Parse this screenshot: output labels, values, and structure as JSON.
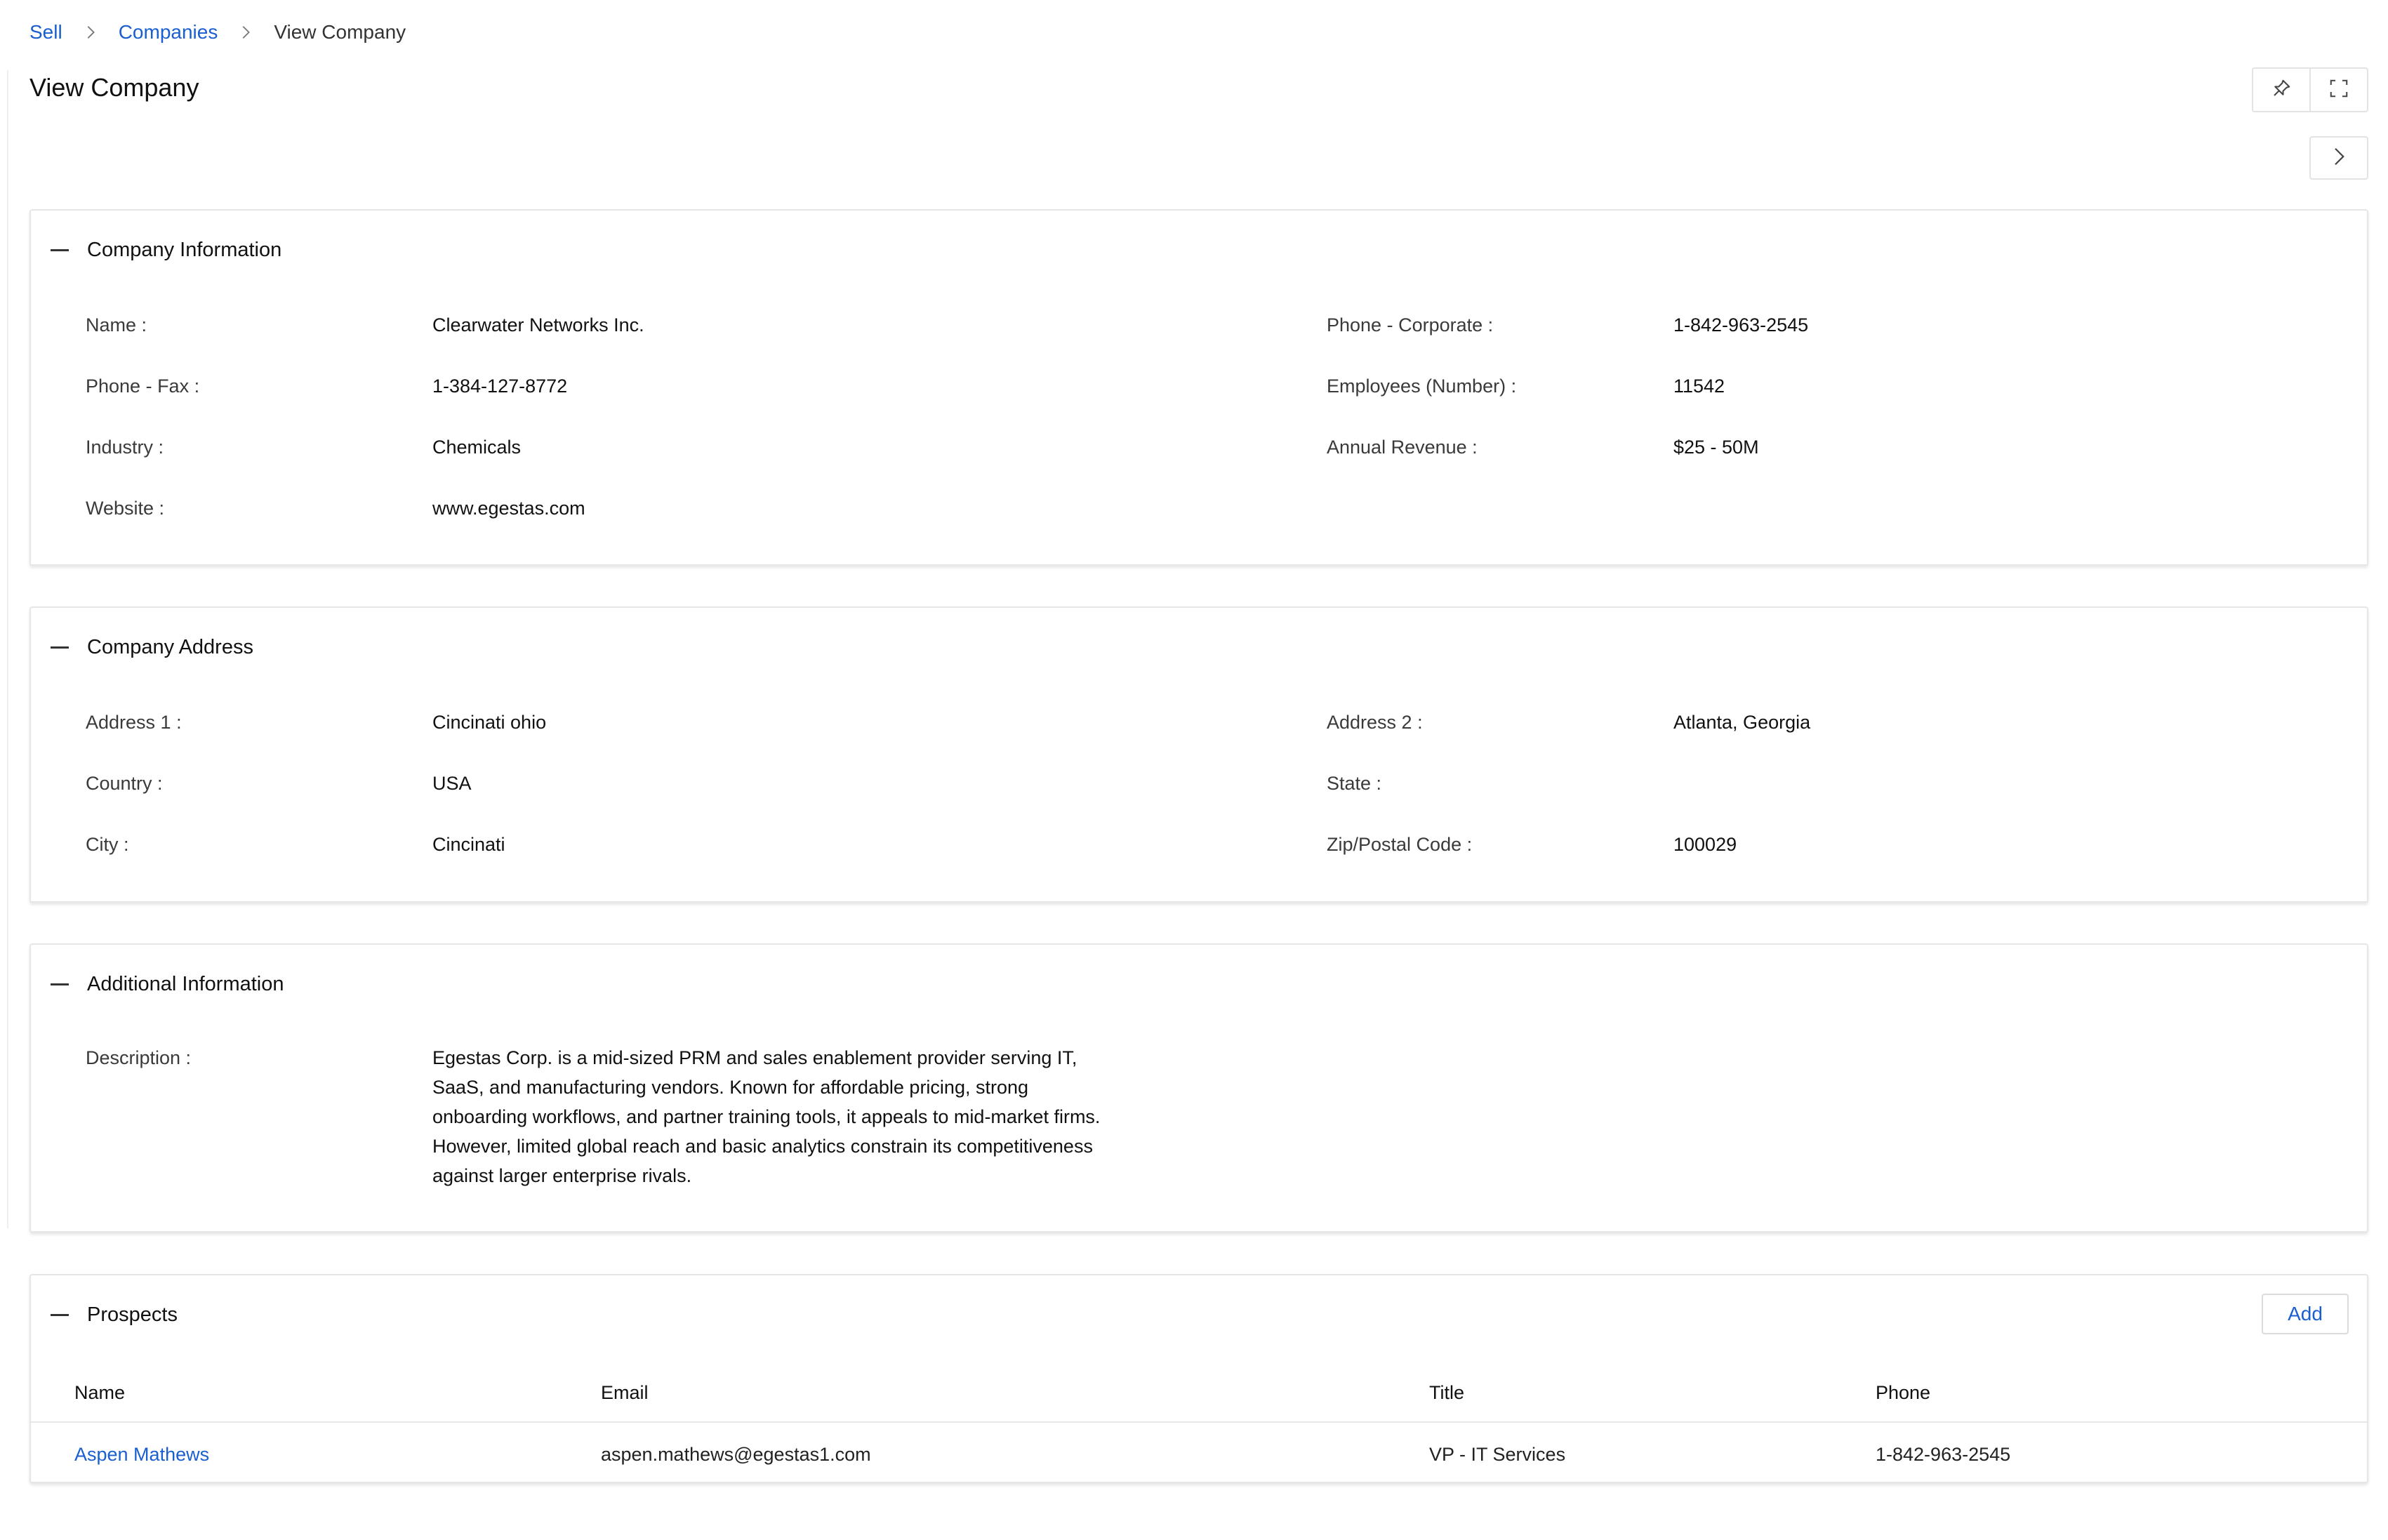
{
  "breadcrumb": {
    "items": [
      "Sell",
      "Companies"
    ],
    "current": "View Company"
  },
  "page": {
    "title": "View Company"
  },
  "toolbar": {
    "pin_icon": "pin-icon",
    "fullscreen_icon": "fullscreen-icon",
    "next_icon": "chevron-right-icon"
  },
  "company_info": {
    "title": "Company Information",
    "fields": [
      {
        "label": "Name :",
        "value": "Clearwater Networks Inc."
      },
      {
        "label": "Phone - Corporate :",
        "value": "1-842-963-2545"
      },
      {
        "label": "Phone - Fax :",
        "value": "1-384-127-8772"
      },
      {
        "label": "Employees (Number) :",
        "value": "11542"
      },
      {
        "label": "Industry :",
        "value": "Chemicals"
      },
      {
        "label": "Annual Revenue :",
        "value": "$25 - 50M"
      },
      {
        "label": "Website :",
        "value": "www.egestas.com"
      }
    ]
  },
  "company_address": {
    "title": "Company Address",
    "fields": [
      {
        "label": "Address 1 :",
        "value": "Cincinati ohio"
      },
      {
        "label": "Address 2 :",
        "value": "Atlanta, Georgia"
      },
      {
        "label": "Country :",
        "value": "USA"
      },
      {
        "label": "State :",
        "value": ""
      },
      {
        "label": "City :",
        "value": "Cincinati"
      },
      {
        "label": "Zip/Postal Code :",
        "value": "100029"
      }
    ]
  },
  "additional_info": {
    "title": "Additional Information",
    "description_label": "Description :",
    "description": "Egestas Corp. is a mid-sized PRM and sales enablement provider serving IT, SaaS, and manufacturing vendors. Known for affordable pricing, strong onboarding workflows, and partner training tools, it appeals to mid-market firms. However, limited global reach and basic analytics constrain its competitiveness against larger enterprise rivals."
  },
  "prospects": {
    "title": "Prospects",
    "add_label": "Add",
    "columns": [
      "Name",
      "Email",
      "Title",
      "Phone"
    ],
    "rows": [
      [
        "Aspen Mathews",
        "aspen.mathews@egestas1.com",
        "VP - IT Services",
        "1-842-963-2545"
      ]
    ]
  },
  "colors": {
    "link": "#1a5fd0",
    "border": "#e6e6e6",
    "text": "#111111"
  }
}
